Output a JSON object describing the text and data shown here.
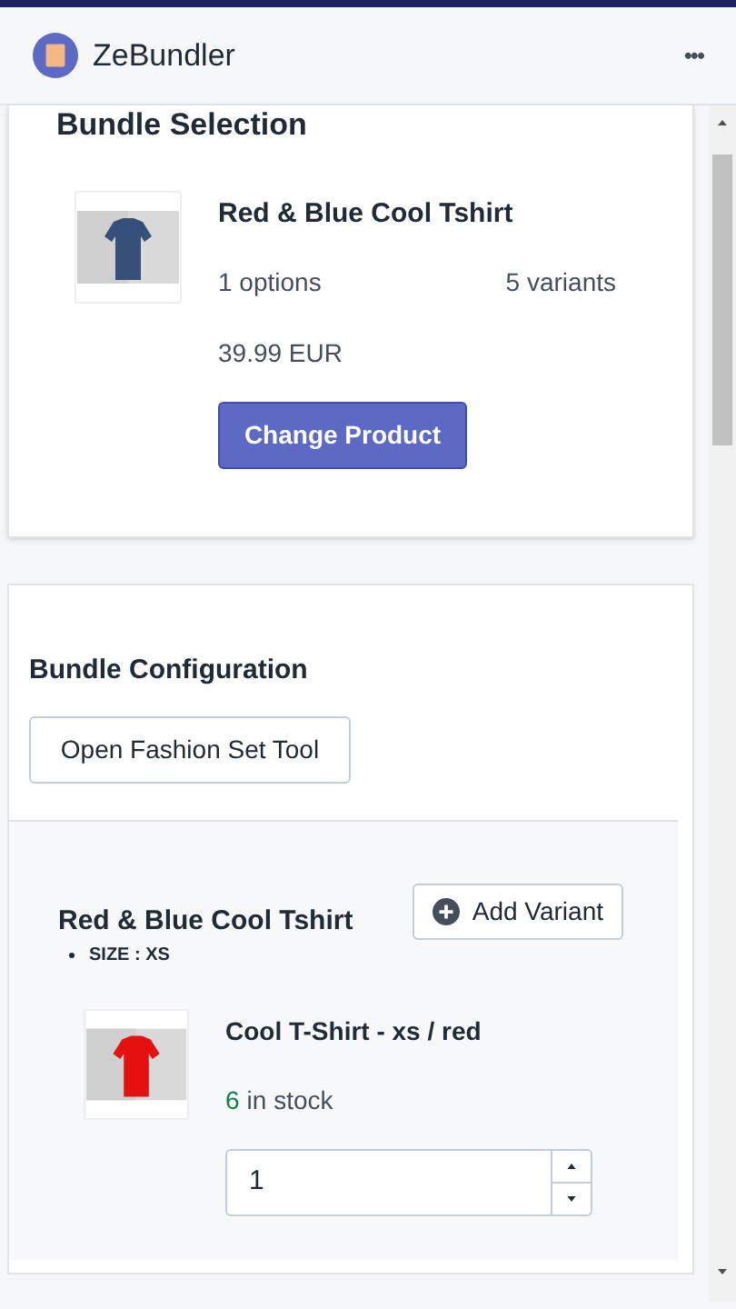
{
  "app": {
    "title": "ZeBundler",
    "menu": "•••"
  },
  "bundle_selection": {
    "heading": "Bundle Selection",
    "product": {
      "title": "Red & Blue Cool Tshirt",
      "options": "1 options",
      "variants": "5 variants",
      "price": "39.99 EUR"
    },
    "button": "Change Product"
  },
  "bundle_configuration": {
    "heading": "Bundle Configuration",
    "button": "Open Fashion Set Tool",
    "item": {
      "title": "Red & Blue Cool Tshirt",
      "options": [
        "SIZE : XS"
      ],
      "add_button": "Add Variant",
      "variant": {
        "name": "Cool T-Shirt - xs / red",
        "stock_count": "6",
        "stock_label": "in stock",
        "quantity": "1"
      }
    }
  }
}
